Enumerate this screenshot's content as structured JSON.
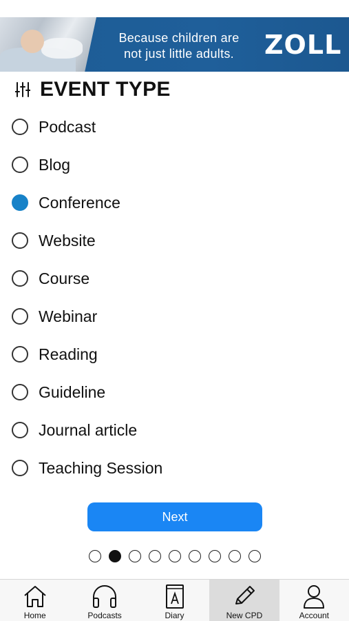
{
  "banner": {
    "tagline_line1": "Because children are",
    "tagline_line2": "not just little adults.",
    "logo_text": "ZOLL",
    "bg_color": "#1d5c95"
  },
  "heading": {
    "icon": "filter-sliders-icon",
    "title": "EVENT TYPE"
  },
  "options": [
    {
      "label": "Podcast",
      "selected": false
    },
    {
      "label": "Blog",
      "selected": false
    },
    {
      "label": "Conference",
      "selected": true
    },
    {
      "label": "Website",
      "selected": false
    },
    {
      "label": "Course",
      "selected": false
    },
    {
      "label": "Webinar",
      "selected": false
    },
    {
      "label": "Reading",
      "selected": false
    },
    {
      "label": "Guideline",
      "selected": false
    },
    {
      "label": "Journal article",
      "selected": false
    },
    {
      "label": "Teaching Session",
      "selected": false
    }
  ],
  "selected_color": "#1782c8",
  "next_button": {
    "label": "Next",
    "color": "#1a86f4"
  },
  "pagination": {
    "total": 9,
    "current": 2
  },
  "tabbar": {
    "tabs": [
      {
        "label": "Home",
        "icon": "home-icon",
        "active": false
      },
      {
        "label": "Podcasts",
        "icon": "headphones-icon",
        "active": false
      },
      {
        "label": "Diary",
        "icon": "diary-book-icon",
        "active": false
      },
      {
        "label": "New CPD",
        "icon": "pencil-icon",
        "active": true
      },
      {
        "label": "Account",
        "icon": "person-icon",
        "active": false
      }
    ]
  }
}
